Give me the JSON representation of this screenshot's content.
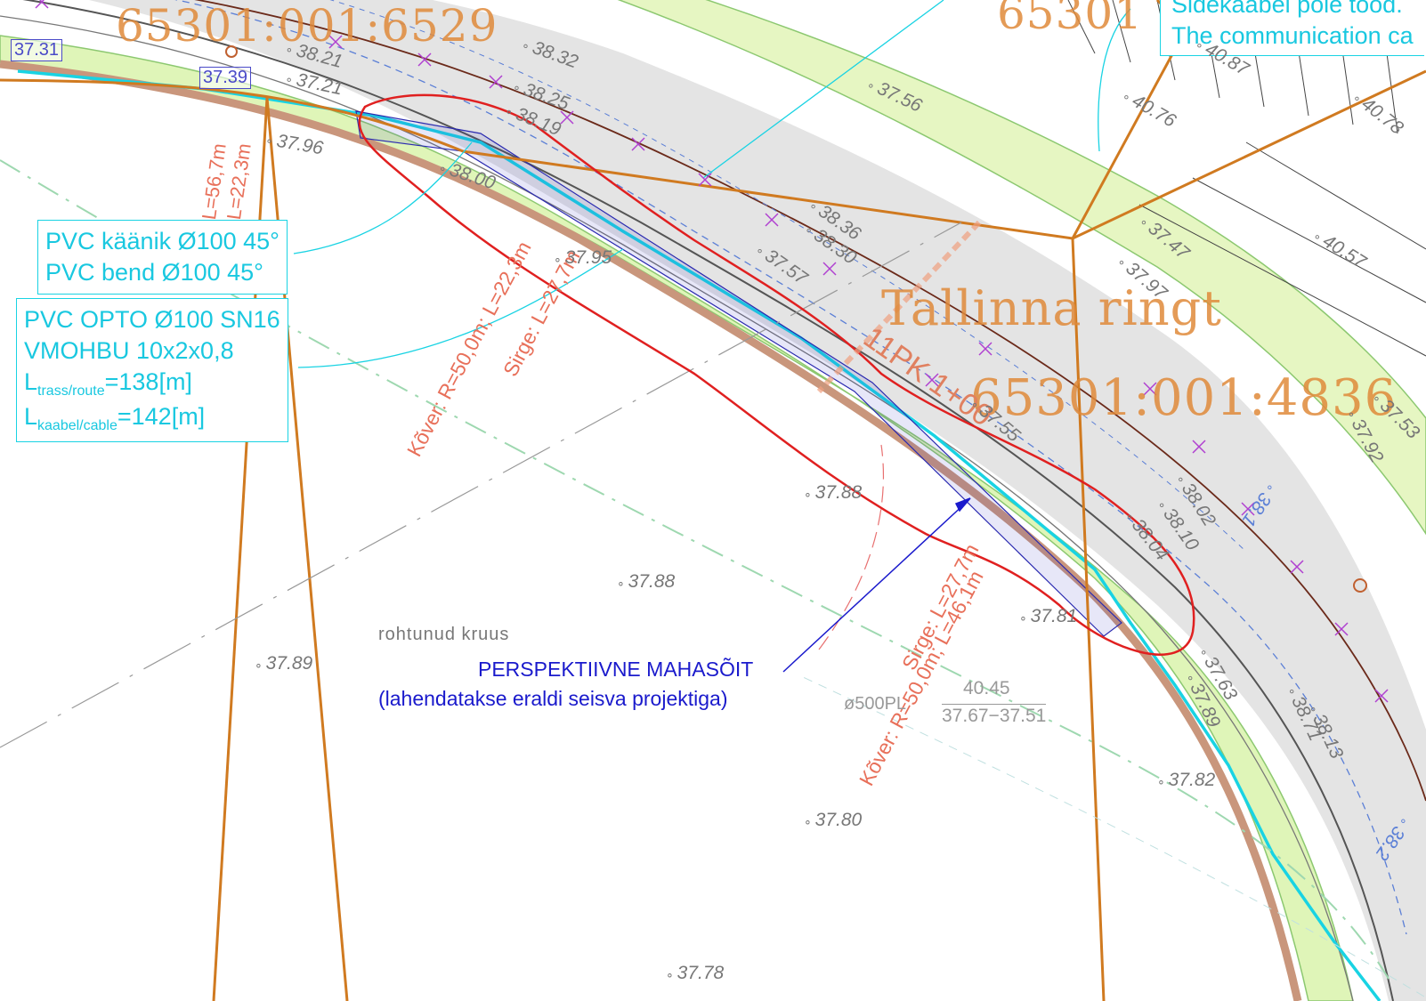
{
  "parcels": {
    "p1": "65301:001:6529",
    "p2": "65301",
    "p3": "Tallinna ringt",
    "p4": "65301:001:4836"
  },
  "header_note": {
    "line1": "Sidekaabel pole tööd.",
    "line2": "The communication ca"
  },
  "boxes": {
    "bend": {
      "line1": "PVC käänik Ø100 45°",
      "line2": "PVC bend Ø100 45°"
    },
    "duct": {
      "line1": "PVC OPTO Ø100 SN16",
      "line2": "VMOHBU 10x2x0,8",
      "route_L": "L",
      "route_sub": "trass/route",
      "route_val": "=138[m]",
      "cable_L": "L",
      "cable_sub": "kaabel/cable",
      "cable_val": "=142[m]"
    }
  },
  "tags": {
    "t1": "37.31",
    "t2": "37.39"
  },
  "curve_labels": {
    "left_top": "L=56,7m",
    "left_top2": "L=22,3m",
    "mid_a": "Kõver: R=50,0m; L=22,3m",
    "mid_b": "Sirge: L=27,7m",
    "right_a": "Sirge: L=27,7m",
    "right_b": "Kõver: R=50,0m; L=46,1m"
  },
  "chainage": "11PK 1+00",
  "access_note": {
    "line1": "PERSPEKTIIVNE MAHASÕIT",
    "line2": "(lahendatakse eraldi seisva projektiga)"
  },
  "surface": "rohtunud kruus",
  "pipe": {
    "dia": "ø500PL",
    "top": "40.45",
    "inv": "37.67−37.51"
  },
  "spot_heights": {
    "h1": "37.88",
    "h2": "37.88",
    "h3": "37.89",
    "h4": "37.80",
    "h5": "37.78",
    "h6": "37.81",
    "h7": "37.82",
    "h8": "37.96",
    "h9": "38.00",
    "h10": "37.95",
    "h11": "37.56",
    "h12": "40.76",
    "h13": "40.57",
    "h14": "37.47",
    "h15": "37.97",
    "h16": "38.32",
    "h17": "38.25",
    "h18": "38.19",
    "h19": "38.36",
    "h20": "38.30",
    "h21": "37.57",
    "h22": "38.04",
    "h23": "38.10",
    "h24": "38.02",
    "h25": "38.13",
    "h26": "38.71",
    "h27": "37.92",
    "h28": "37.63",
    "h29": "37.89",
    "h30": "40.87",
    "h31": "40.78",
    "h32": "37.53",
    "h33": "37.55",
    "h34": "38.1",
    "h35": "38.2",
    "h36": "37.21",
    "h37": "38.21"
  }
}
